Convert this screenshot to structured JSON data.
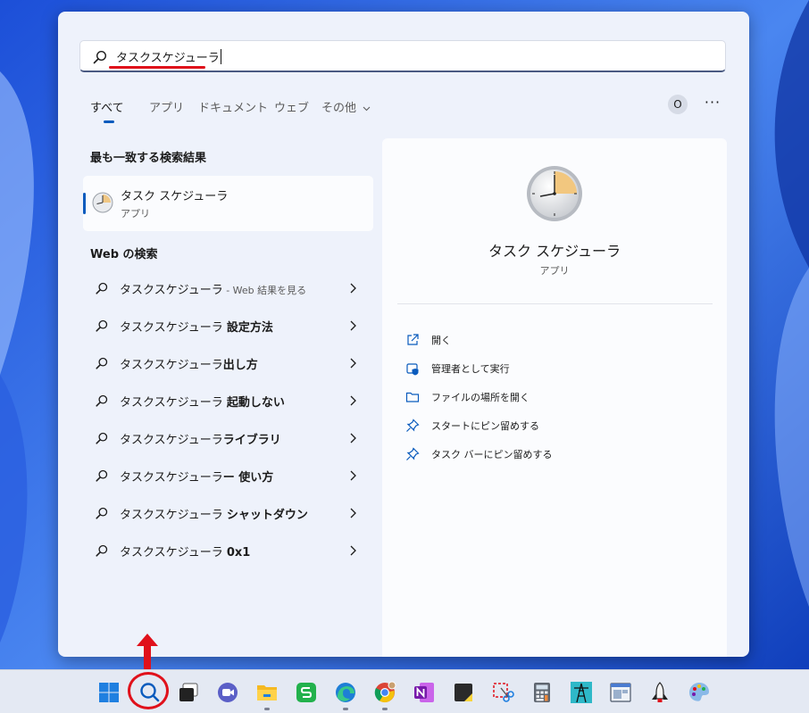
{
  "search": {
    "query": "タスクスケジューラ"
  },
  "tabs": {
    "all": "すべて",
    "apps": "アプリ",
    "documents": "ドキュメント",
    "web": "ウェブ",
    "more": "その他",
    "profile_initial": "O",
    "more_options": "···"
  },
  "best_match": {
    "heading": "最も一致する検索結果",
    "name": "タスク スケジューラ",
    "type": "アプリ",
    "icon": "clock-icon"
  },
  "web_search": {
    "heading": "Web の検索",
    "items": [
      {
        "prefix": "タスクスケジューラ",
        "sub": " - Web 結果を見る",
        "bold": ""
      },
      {
        "prefix": "タスクスケジューラ ",
        "sub": "",
        "bold": "設定方法"
      },
      {
        "prefix": "タスクスケジューラ",
        "sub": "",
        "bold": "出し方"
      },
      {
        "prefix": "タスクスケジューラ ",
        "sub": "",
        "bold": "起動しない"
      },
      {
        "prefix": "タスクスケジューラ",
        "sub": "",
        "bold": "ライブラリ"
      },
      {
        "prefix": "タスクスケジューラ",
        "sub": "",
        "bold": "ー 使い方"
      },
      {
        "prefix": "タスクスケジューラ ",
        "sub": "",
        "bold": "シャットダウン"
      },
      {
        "prefix": "タスクスケジューラ ",
        "sub": "",
        "bold": "0x1"
      }
    ]
  },
  "details": {
    "name": "タスク スケジューラ",
    "type": "アプリ",
    "actions": [
      {
        "label": "開く",
        "icon": "open-icon"
      },
      {
        "label": "管理者として実行",
        "icon": "shield-icon"
      },
      {
        "label": "ファイルの場所を開く",
        "icon": "folder-icon"
      },
      {
        "label": "スタートにピン留めする",
        "icon": "pin-icon"
      },
      {
        "label": "タスク バーにピン留めする",
        "icon": "pin-icon"
      }
    ]
  },
  "taskbar": {
    "items": [
      "windows-start-icon",
      "search-icon",
      "task-view-icon",
      "chat-icon",
      "file-explorer-icon",
      "app-s-icon",
      "edge-icon",
      "chrome-icon",
      "onenote-icon",
      "sticky-notes-icon",
      "snipping-tool-icon",
      "calculator-icon",
      "tower-app-icon",
      "window-app-icon",
      "rocket-app-icon",
      "paint-icon"
    ]
  },
  "colors": {
    "accent": "#0a5bbd",
    "annotation_red": "#e0111b",
    "panel_bg": "#eef2fb"
  }
}
